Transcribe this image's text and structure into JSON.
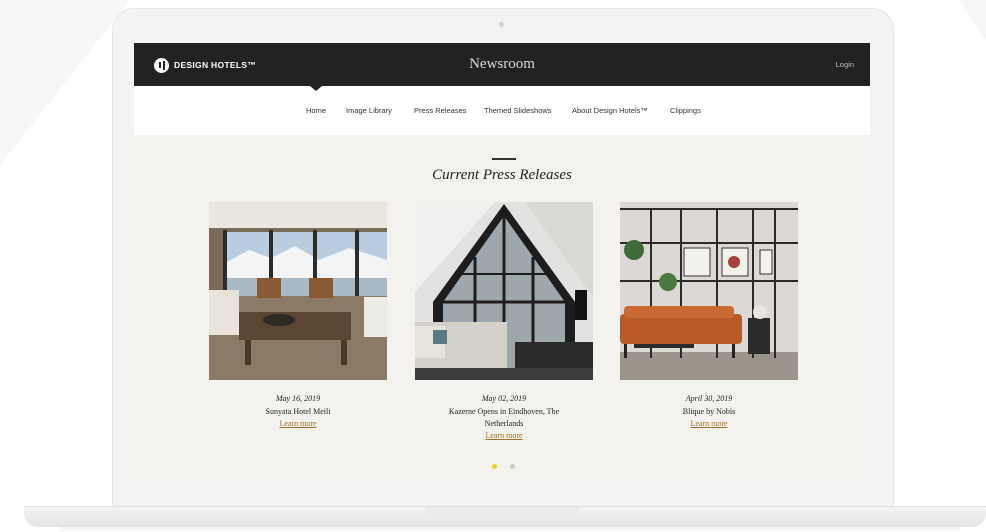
{
  "header": {
    "brand": "DESIGN HOTELS™",
    "title": "Newsroom",
    "login_label": "Login"
  },
  "nav": {
    "items": [
      {
        "label": "Home"
      },
      {
        "label": "Image Library"
      },
      {
        "label": "Press Releases"
      },
      {
        "label": "Themed Slideshows"
      },
      {
        "label": "About Design Hotels™"
      },
      {
        "label": "Clippings"
      }
    ],
    "active": "Home"
  },
  "main": {
    "heading": "Current Press Releases",
    "releases": [
      {
        "date": "May 16, 2019",
        "title": "Sunyata Hotel Meili",
        "link": "Learn more"
      },
      {
        "date": "May 02, 2019",
        "title": "Kazerne Opens in Eindhoven, The Netherlands",
        "link": "Learn more"
      },
      {
        "date": "April 30, 2019",
        "title": "Blique by Nobis",
        "link": "Learn more"
      }
    ]
  },
  "carousel": {
    "dot_count": 2,
    "active_index": 0,
    "active_color": "#f1d21a",
    "inactive_color": "#cccccc"
  },
  "colors": {
    "topbar": "#222222",
    "link": "#a57128",
    "page_bg": "#f3f2ee"
  }
}
